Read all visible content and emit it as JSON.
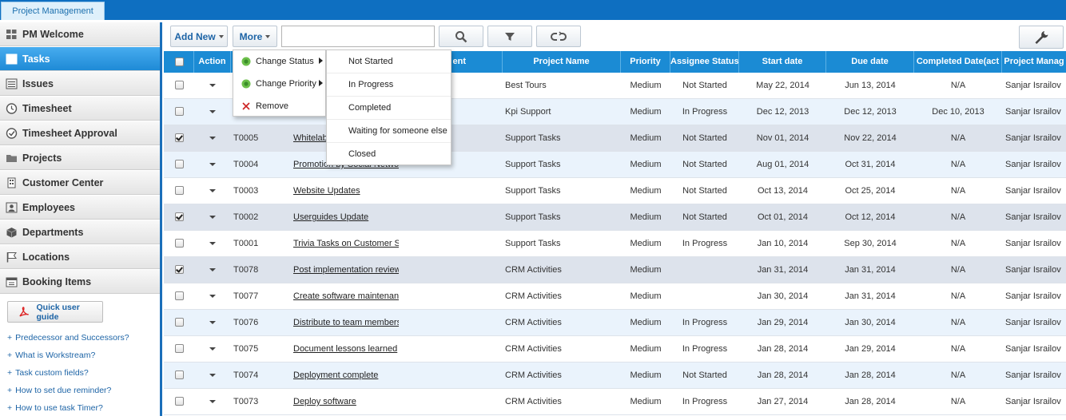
{
  "app": {
    "tab_label": "Project Management"
  },
  "sidebar": {
    "items": [
      {
        "label": "PM Welcome",
        "icon": "grid-icon",
        "active": false
      },
      {
        "label": "Tasks",
        "icon": "list-icon",
        "active": true
      },
      {
        "label": "Issues",
        "icon": "list-icon",
        "active": false
      },
      {
        "label": "Timesheet",
        "icon": "clock-icon",
        "active": false
      },
      {
        "label": "Timesheet Approval",
        "icon": "check-circle-icon",
        "active": false
      },
      {
        "label": "Projects",
        "icon": "folder-icon",
        "active": false
      },
      {
        "label": "Customer Center",
        "icon": "building-icon",
        "active": false
      },
      {
        "label": "Employees",
        "icon": "person-icon",
        "active": false
      },
      {
        "label": "Departments",
        "icon": "cube-icon",
        "active": false
      },
      {
        "label": "Locations",
        "icon": "flag-icon",
        "active": false
      },
      {
        "label": "Booking Items",
        "icon": "calendar-icon",
        "active": false
      }
    ],
    "guide_button": "Quick user guide",
    "help_links": [
      "Predecessor and Successors?",
      "What is Workstream?",
      "Task custom fields?",
      "How to set due reminder?",
      "How to use task Timer?"
    ]
  },
  "toolbar": {
    "add_new": "Add New",
    "more": "More",
    "search_value": ""
  },
  "columns": {
    "action": "Action",
    "assignment": "ent",
    "project_name": "Project Name",
    "priority": "Priority",
    "assignee_status": "Assignee Status",
    "start_date": "Start date",
    "due_date": "Due date",
    "completed_date": "Completed Date(act",
    "project_manager": "Project Manag"
  },
  "rows": [
    {
      "checked": false,
      "id": "",
      "name": "",
      "project": "Best Tours",
      "priority": "Medium",
      "status": "Not Started",
      "start": "May 22, 2014",
      "due": "Jun 13, 2014",
      "completed": "N/A",
      "pm": "Sanjar Israilov"
    },
    {
      "checked": false,
      "id": "",
      "name": "",
      "project": "Kpi Support",
      "priority": "Medium",
      "status": "In Progress",
      "start": "Dec 12, 2013",
      "due": "Dec 12, 2013",
      "completed": "Dec 10, 2013",
      "pm": "Sanjar Israilov"
    },
    {
      "checked": true,
      "id": "T0005",
      "name": "Whitelab",
      "project": "Support Tasks",
      "priority": "Medium",
      "status": "Not Started",
      "start": "Nov 01, 2014",
      "due": "Nov 22, 2014",
      "completed": "N/A",
      "pm": "Sanjar Israilov"
    },
    {
      "checked": false,
      "id": "T0004",
      "name": "Promotion by Social Networ",
      "project": "Support Tasks",
      "priority": "Medium",
      "status": "Not Started",
      "start": "Aug 01, 2014",
      "due": "Oct 31, 2014",
      "completed": "N/A",
      "pm": "Sanjar Israilov"
    },
    {
      "checked": false,
      "id": "T0003",
      "name": "Website Updates",
      "project": "Support Tasks",
      "priority": "Medium",
      "status": "Not Started",
      "start": "Oct 13, 2014",
      "due": "Oct 25, 2014",
      "completed": "N/A",
      "pm": "Sanjar Israilov"
    },
    {
      "checked": true,
      "id": "T0002",
      "name": "Userguides Update",
      "project": "Support Tasks",
      "priority": "Medium",
      "status": "Not Started",
      "start": "Oct 01, 2014",
      "due": "Oct 12, 2014",
      "completed": "N/A",
      "pm": "Sanjar Israilov"
    },
    {
      "checked": false,
      "id": "T0001",
      "name": "Trivia Tasks on Customer S",
      "project": "Support Tasks",
      "priority": "Medium",
      "status": "In Progress",
      "start": "Jan 10, 2014",
      "due": "Sep 30, 2014",
      "completed": "N/A",
      "pm": "Sanjar Israilov"
    },
    {
      "checked": true,
      "id": "T0078",
      "name": "Post implementation review",
      "project": "CRM Activities",
      "priority": "Medium",
      "status": "",
      "start": "Jan 31, 2014",
      "due": "Jan 31, 2014",
      "completed": "N/A",
      "pm": "Sanjar Israilov"
    },
    {
      "checked": false,
      "id": "T0077",
      "name": "Create software maintenan",
      "project": "CRM Activities",
      "priority": "Medium",
      "status": "",
      "start": "Jan 30, 2014",
      "due": "Jan 31, 2014",
      "completed": "N/A",
      "pm": "Sanjar Israilov"
    },
    {
      "checked": false,
      "id": "T0076",
      "name": "Distribute to team members",
      "project": "CRM Activities",
      "priority": "Medium",
      "status": "In Progress",
      "start": "Jan 29, 2014",
      "due": "Jan 30, 2014",
      "completed": "N/A",
      "pm": "Sanjar Israilov"
    },
    {
      "checked": false,
      "id": "T0075",
      "name": "Document lessons learned",
      "project": "CRM Activities",
      "priority": "Medium",
      "status": "In Progress",
      "start": "Jan 28, 2014",
      "due": "Jan 29, 2014",
      "completed": "N/A",
      "pm": "Sanjar Israilov"
    },
    {
      "checked": false,
      "id": "T0074",
      "name": "Deployment complete",
      "project": "CRM Activities",
      "priority": "Medium",
      "status": "Not Started",
      "start": "Jan 28, 2014",
      "due": "Jan 28, 2014",
      "completed": "N/A",
      "pm": "Sanjar Israilov"
    },
    {
      "checked": false,
      "id": "T0073",
      "name": "Deploy software",
      "project": "CRM Activities",
      "priority": "Medium",
      "status": "In Progress",
      "start": "Jan 27, 2014",
      "due": "Jan 28, 2014",
      "completed": "N/A",
      "pm": "Sanjar Israilov"
    }
  ],
  "context_menu": {
    "items": [
      {
        "label": "Change Status",
        "icon": "status-dot-icon",
        "has_submenu": true
      },
      {
        "label": "Change Priority",
        "icon": "status-dot-icon",
        "has_submenu": true
      },
      {
        "label": "Remove",
        "icon": "remove-x-icon",
        "has_submenu": false
      }
    ]
  },
  "status_submenu": [
    "Not Started",
    "In Progress",
    "Completed",
    "Waiting for someone else",
    "Closed"
  ]
}
